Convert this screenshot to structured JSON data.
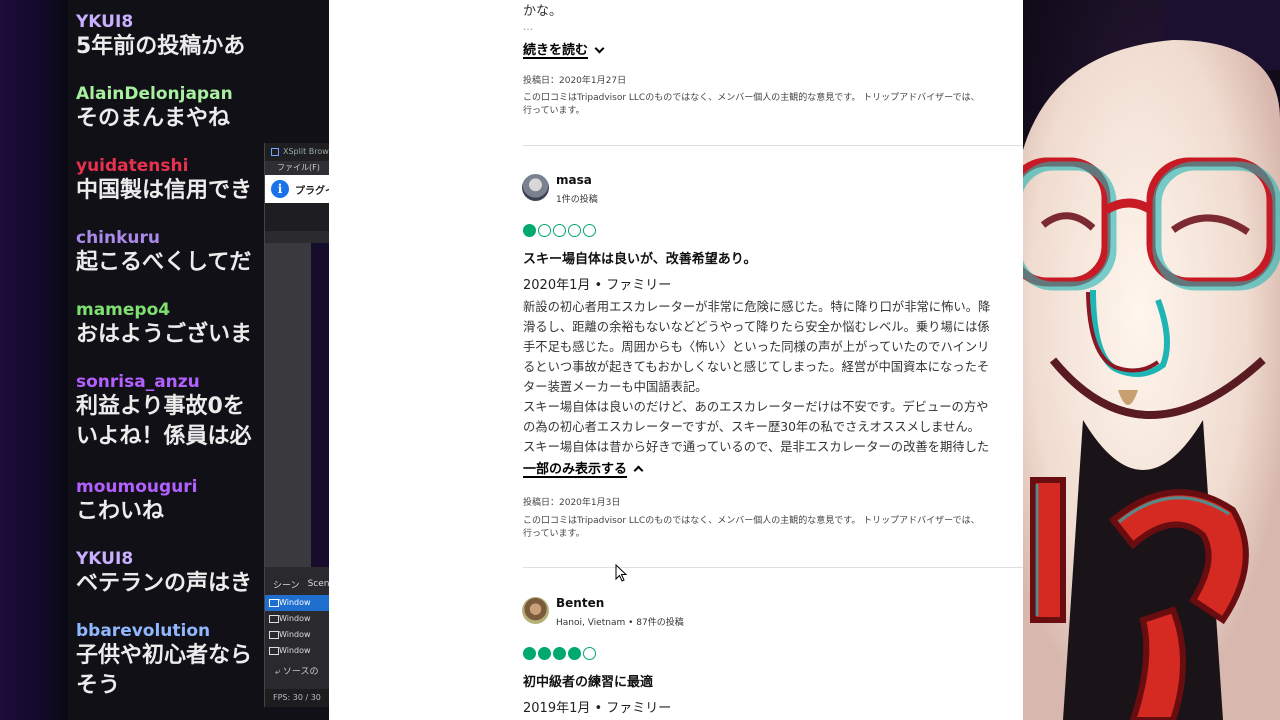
{
  "chat": {
    "messages": [
      {
        "user": "YKUI8",
        "color": "#c9b0ff",
        "lines": [
          "5年前の投稿かあ"
        ]
      },
      {
        "user": "AlainDelonjapan",
        "color": "#a8f0a0",
        "lines": [
          "そのまんまやね"
        ]
      },
      {
        "user": "yuidatenshi",
        "color": "#e8314f",
        "lines": [
          "中国製は信用でき"
        ]
      },
      {
        "user": "chinkuru",
        "color": "#a98ae8",
        "lines": [
          "起こるべくしてだ"
        ]
      },
      {
        "user": "mamepo4",
        "color": "#7ee06f",
        "lines": [
          "おはようございま"
        ]
      },
      {
        "user": "sonrisa_anzu",
        "color": "#b260ff",
        "lines": [
          "利益より事故0を",
          "いよね！係員は必"
        ]
      },
      {
        "user": "moumouguri",
        "color": "#b260ff",
        "lines": [
          "こわいね"
        ]
      },
      {
        "user": "YKUI8",
        "color": "#c9b0ff",
        "lines": [
          "ベテランの声はき"
        ]
      },
      {
        "user": "bbarevolution",
        "color": "#8fb8ff",
        "lines": [
          "子供や初心者なら",
          "そう"
        ]
      }
    ]
  },
  "xsplit": {
    "title": "XSplit Brow",
    "menu": "ファイル(F)",
    "info": "プラグイ",
    "scene_tabs": [
      "シーン",
      "Scen"
    ],
    "sources": [
      "Window",
      "Window",
      "Window",
      "Window"
    ],
    "add_source": "ソースの",
    "fps": "FPS:  30 / 30"
  },
  "page": {
    "top_text": "かな。",
    "ellipsis": "…",
    "read_more": "続きを読む",
    "review0": {
      "posted": "投稿日：2020年1月27日",
      "disclaimer": "この口コミはTripadvisor LLCのものではなく、メンバー個人の主観的な意見です。 トリップアドバイザーでは、\n行っています。"
    },
    "review1": {
      "name": "masa",
      "sub": "1件の投稿",
      "rating": 1,
      "title": "スキー場自体は良いが、改善希望あり。",
      "meta": "2020年1月 • ファミリー",
      "body": "新設の初心者用エスカレーターが非常に危険に感じた。特に降り口が非常に怖い。降\n滑るし、距離の余裕もないなどどうやって降りたら安全か悩むレベル。乗り場には係\n手不足も感じた。周囲からも〈怖い〉といった同様の声が上がっていたのでハインリ\nるといつ事故が起きてもおかしくないと感じてしまった。経営が中国資本になったそ\nター装置メーカーも中国語表記。\nスキー場自体は良いのだけど、あのエスカレーターだけは不安です。デビューの方や\nの為の初心者エスカレーターですが、スキー歴30年の私でさえオススメしません。\nスキー場自体は昔から好きで通っているので、是非エスカレーターの改善を期待した",
      "show_less": "一部のみ表示する",
      "posted": "投稿日：2020年1月3日",
      "disclaimer": "この口コミはTripadvisor LLCのものではなく、メンバー個人の主観的な意見です。 トリップアドバイザーでは、\n行っています。"
    },
    "review2": {
      "name": "Benten",
      "sub": "Hanoi, Vietnam • 87件の投稿",
      "rating": 4,
      "title": "初中級者の練習に最適",
      "meta": "2019年1月 • ファミリー"
    }
  },
  "colors": {
    "rating_green": "#00aa6c",
    "chat_bg": "#121017",
    "xsplit_accent": "#1e6fd0"
  }
}
